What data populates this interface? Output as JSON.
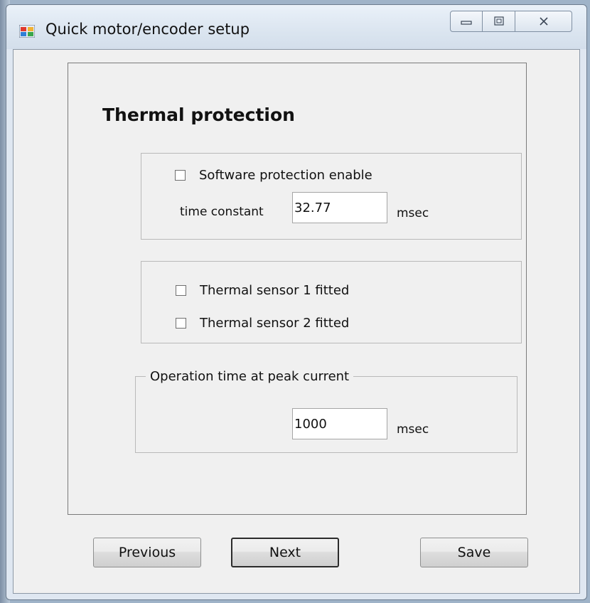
{
  "window": {
    "title": "Quick motor/encoder setup",
    "icons": {
      "app": "app-window-icon",
      "minimize": "minimize-icon",
      "maximize": "maximize-icon",
      "close": "close-icon"
    }
  },
  "page": {
    "title": "Thermal protection"
  },
  "software_protection": {
    "enable_label": "Software protection enable",
    "enabled": false,
    "time_constant_label": "time constant",
    "time_constant_value": "32.77",
    "time_constant_unit": "msec"
  },
  "sensors": {
    "sensor1_label": "Thermal sensor 1 fitted",
    "sensor1_checked": false,
    "sensor2_label": "Thermal sensor 2 fitted",
    "sensor2_checked": false
  },
  "peak_current": {
    "group_label": "Operation time at peak current",
    "value": "1000",
    "unit": "msec"
  },
  "buttons": {
    "previous": "Previous",
    "next": "Next",
    "save": "Save"
  },
  "colors": {
    "titlebar": "#dbe5f0",
    "client_bg": "#f0f0f0",
    "border": "#7a7a7a"
  }
}
